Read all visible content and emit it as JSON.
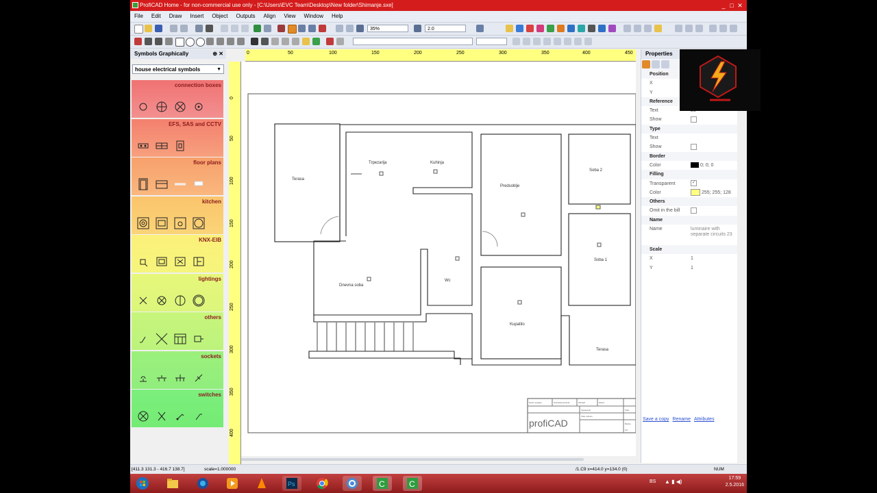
{
  "window": {
    "title": "ProfiCAD Home - for non-commercial use only - [C:\\Users\\EVC Team\\Desktop\\New folder\\Shimanje.sxe]",
    "controls": [
      "_",
      "□",
      "✕"
    ]
  },
  "menu": [
    "File",
    "Edit",
    "Draw",
    "Insert",
    "Object",
    "Outputs",
    "Align",
    "View",
    "Window",
    "Help"
  ],
  "toolbar": {
    "zoom_value": "35%",
    "line_width_value": "2.0"
  },
  "symbols_panel": {
    "title": "Symbols Graphically",
    "pin": "⊕",
    "close": "✕",
    "selected_library": "house electrical symbols",
    "categories": [
      {
        "label": "connection boxes",
        "color": "#f07272"
      },
      {
        "label": "EFS, SAS and CCTV",
        "color": "#f5866e"
      },
      {
        "label": "floor plans",
        "color": "#f8a06c"
      },
      {
        "label": "kitchen",
        "color": "#fac46c"
      },
      {
        "label": "KNX-EIB",
        "color": "#fbf07a"
      },
      {
        "label": "lightings",
        "color": "#e6f77a"
      },
      {
        "label": "others",
        "color": "#c8f57c"
      },
      {
        "label": "sockets",
        "color": "#9cf07c"
      },
      {
        "label": "switches",
        "color": "#7cee7c"
      }
    ]
  },
  "rulers": {
    "top": [
      "0",
      "50",
      "100",
      "150",
      "200",
      "250",
      "300",
      "350",
      "400",
      "450"
    ],
    "left": [
      "0",
      "50",
      "100",
      "150",
      "200",
      "250",
      "300",
      "350",
      "400"
    ]
  },
  "floor_plan": {
    "rooms": [
      "Terasa",
      "Trpezarija",
      "Kuhinja",
      "Predsoblje",
      "Soba 2",
      "Soba 1",
      "Dnevna soba",
      "Wc",
      "Kupatilo",
      "Terasa"
    ],
    "titleblock": {
      "logo_text": "profiCAD",
      "cells": [
        "Nazov projektu",
        "Technicka kontrola",
        "Schvalil",
        "Datum",
        "Vypracoval",
        "Cislo vykresu",
        "Cislo",
        "Mierka",
        "List"
      ]
    }
  },
  "properties": {
    "title": "Properties",
    "rows": [
      {
        "type": "section",
        "label": "Position"
      },
      {
        "label": "X",
        "value": ""
      },
      {
        "label": "Y",
        "value": ""
      },
      {
        "type": "section",
        "label": "Reference"
      },
      {
        "label": "Text",
        "value": "23"
      },
      {
        "label": "Show",
        "value": "",
        "checkbox": true
      },
      {
        "type": "section",
        "label": "Type"
      },
      {
        "label": "Text",
        "value": ""
      },
      {
        "label": "Show",
        "value": "",
        "checkbox": true
      },
      {
        "type": "section",
        "label": "Border"
      },
      {
        "label": "Color",
        "value": "0; 0; 0",
        "swatch": "#000000"
      },
      {
        "type": "section",
        "label": "Filling"
      },
      {
        "label": "Transparent",
        "value": "✓",
        "checkbox": true
      },
      {
        "label": "Color",
        "value": "255; 255; 128",
        "swatch": "#ffff80"
      },
      {
        "type": "section",
        "label": "Others"
      },
      {
        "label": "Omit in the bill",
        "value": "",
        "checkbox": true
      },
      {
        "type": "section",
        "label": "Name"
      },
      {
        "label": "Name",
        "value": "luminaire with separate circuits 23"
      },
      {
        "type": "section",
        "label": "Scale"
      },
      {
        "label": "X",
        "value": "1"
      },
      {
        "label": "Y",
        "value": "1"
      }
    ],
    "links": [
      "Save a copy",
      "Rename",
      "Attributes"
    ]
  },
  "status": {
    "left": "[411.3 131.3 - 416.7 138.7]",
    "scale": "scale=1.000000",
    "coords": "/1.C9 x=414.0 y=134.0 (0)",
    "num": "NUM"
  },
  "taskbar": {
    "lang": "BS",
    "time": "17:59",
    "date": "2.5.2016"
  },
  "colors": {
    "title_bar": "#d41c1c",
    "taskbar": "#b02828",
    "ruler": "#ffff80"
  }
}
